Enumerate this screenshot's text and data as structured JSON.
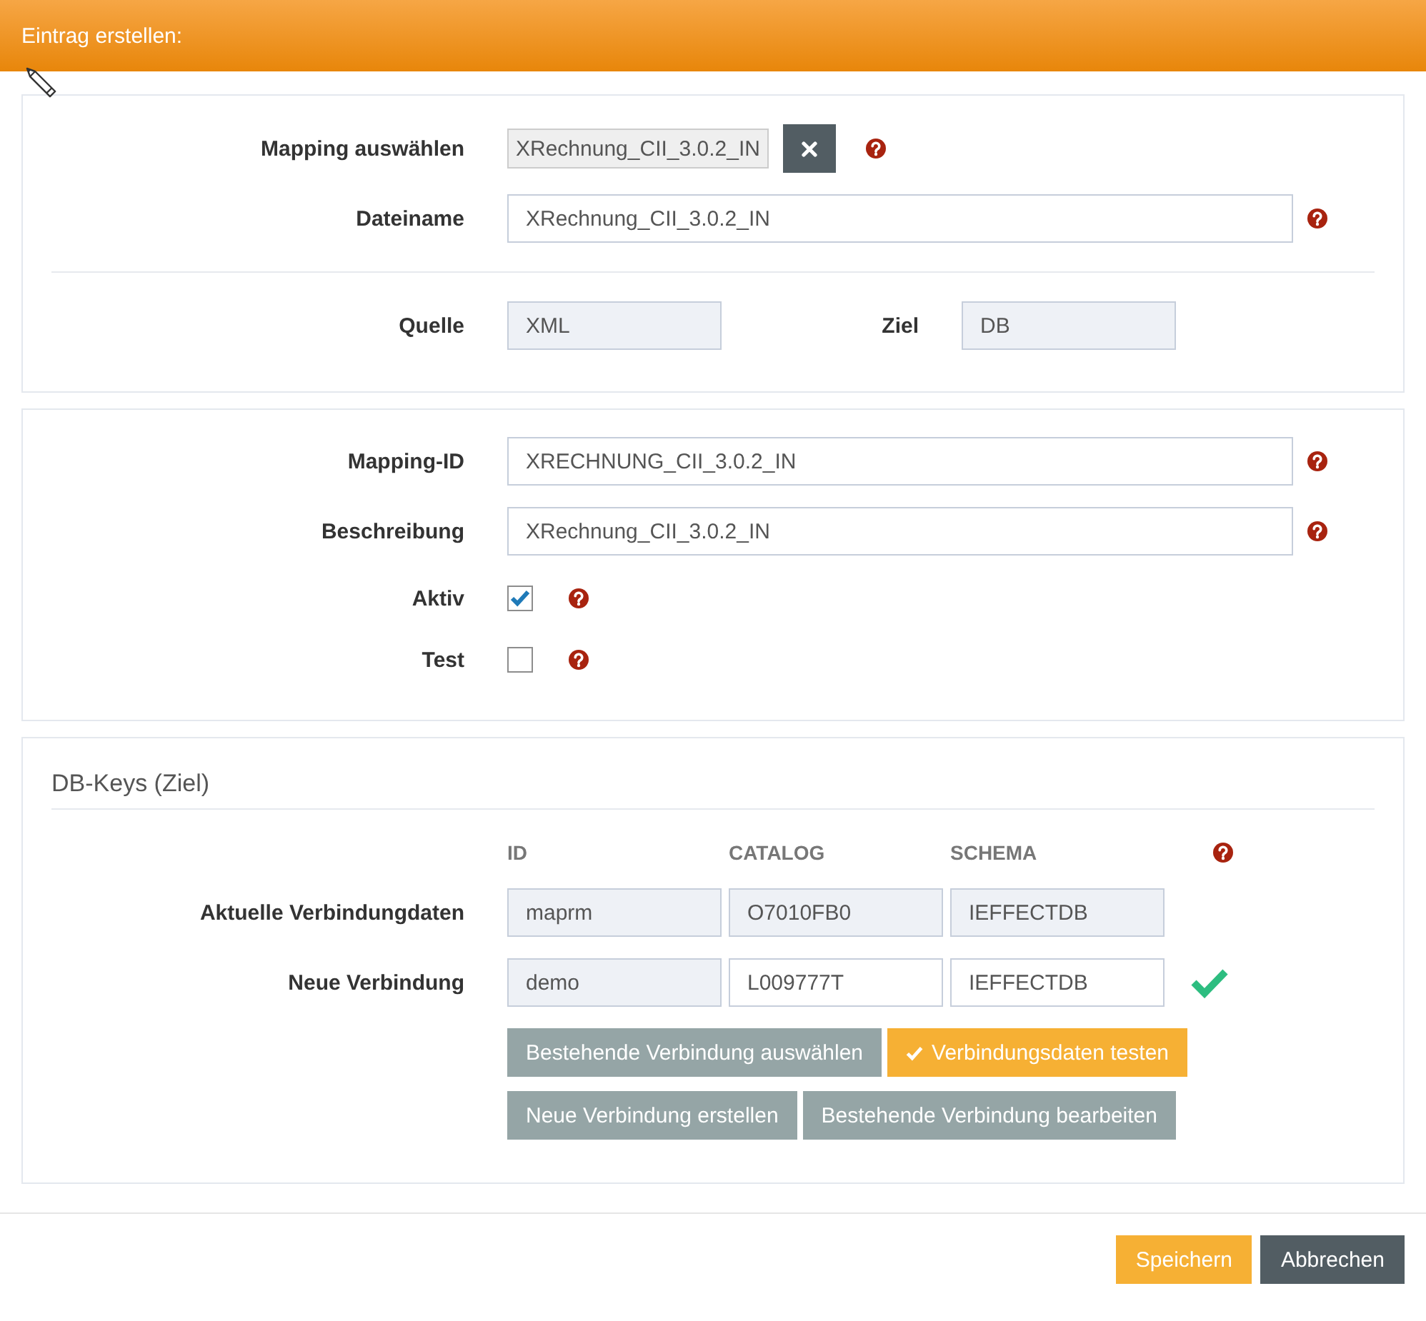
{
  "header": {
    "title": "Eintrag erstellen:"
  },
  "mapping_panel": {
    "mapping": {
      "label": "Mapping auswählen",
      "value": "XRechnung_CII_3.0.2_IN",
      "help": true
    },
    "filename": {
      "label": "Dateiname",
      "value": "XRechnung_CII_3.0.2_IN",
      "readonly": false,
      "help": true
    },
    "source": {
      "label": "Quelle",
      "value": "XML",
      "readonly": true
    },
    "target": {
      "label": "Ziel",
      "value": "DB",
      "readonly": true
    }
  },
  "details_panel": {
    "fields": [
      {
        "kind": "text",
        "label": "Mapping-ID",
        "value": "XRECHNUNG_CII_3.0.2_IN",
        "readonly": false,
        "help": true
      },
      {
        "kind": "text",
        "label": "Beschreibung",
        "value": "XRechnung_CII_3.0.2_IN",
        "readonly": false,
        "help": true
      },
      {
        "kind": "checkbox",
        "label": "Aktiv",
        "checked": true,
        "help": true
      },
      {
        "kind": "checkbox",
        "label": "Test",
        "checked": false,
        "help": true
      }
    ]
  },
  "db_keys_panel": {
    "title": "DB-Keys (Ziel)",
    "columns": [
      "ID",
      "CATALOG",
      "SCHEMA"
    ],
    "help": true,
    "rows": [
      {
        "label": "Aktuelle Verbindungdaten",
        "verified": false,
        "cells": [
          {
            "value": "maprm",
            "readonly": true
          },
          {
            "value": "O7010FB0",
            "readonly": true
          },
          {
            "value": "IEFFECTDB",
            "readonly": true
          }
        ]
      },
      {
        "label": "Neue Verbindung",
        "verified": true,
        "cells": [
          {
            "value": "demo",
            "readonly": true
          },
          {
            "value": "L009777T",
            "readonly": false
          },
          {
            "value": "IEFFECTDB",
            "readonly": false
          }
        ]
      }
    ],
    "button_rows": [
      [
        {
          "label": "Bestehende Verbindung auswählen",
          "kind": "secondary",
          "icon": false
        },
        {
          "label": "Verbindungsdaten testen",
          "kind": "primary",
          "icon": true
        }
      ],
      [
        {
          "label": "Neue Verbindung erstellen",
          "kind": "secondary",
          "icon": false
        },
        {
          "label": "Bestehende Verbindung bearbeiten",
          "kind": "secondary",
          "icon": false
        }
      ]
    ]
  },
  "footer": {
    "buttons": [
      {
        "label": "Speichern",
        "kind": "primary"
      },
      {
        "label": "Abbrechen",
        "kind": "dark"
      }
    ]
  }
}
